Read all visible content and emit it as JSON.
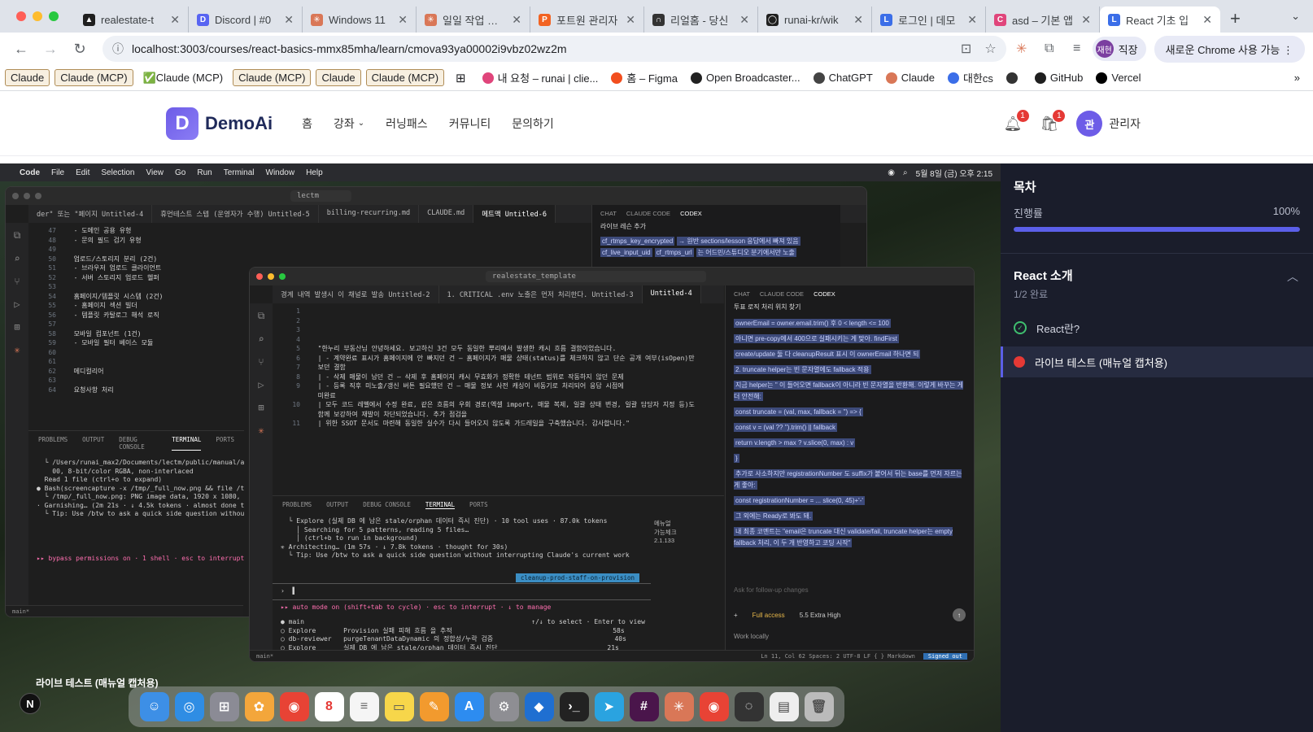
{
  "browser": {
    "tabs": [
      {
        "title": "realestate-t",
        "icon": "github-icon",
        "color": "#1f1f1f",
        "glyph": "▲"
      },
      {
        "title": "Discord | #0",
        "icon": "discord-icon",
        "color": "#5865f2",
        "glyph": "D"
      },
      {
        "title": "Windows 11",
        "icon": "claude-icon",
        "color": "#d97757",
        "glyph": "✳"
      },
      {
        "title": "일일 작업 내역",
        "icon": "claude-icon",
        "color": "#d97757",
        "glyph": "✳"
      },
      {
        "title": "포트원 관리자",
        "icon": "portone-icon",
        "color": "#f26322",
        "glyph": "P"
      },
      {
        "title": "리얼홈 - 당신",
        "icon": "realhome-icon",
        "color": "#333333",
        "glyph": "∩"
      },
      {
        "title": "runai-kr/wik",
        "icon": "github-icon",
        "color": "#1f1f1f",
        "glyph": "◯"
      },
      {
        "title": "로그인 | 데모",
        "icon": "demo-icon",
        "color": "#3b6ee8",
        "glyph": "L"
      },
      {
        "title": "asd – 기본 앱",
        "icon": "app-icon",
        "color": "#e0457b",
        "glyph": "C"
      },
      {
        "title": "React 기초 입",
        "icon": "demo-icon",
        "color": "#3b6ee8",
        "glyph": "L",
        "active": true
      }
    ],
    "url": "localhost:3003/courses/react-basics-mmx85mha/learn/cmova93ya00002i9vbz02wz2m",
    "profile_label": "직장",
    "profile_avatar": "재현",
    "update_label": "새로운 Chrome 사용 가능",
    "bookmarks": [
      {
        "label": "Claude",
        "chip": true
      },
      {
        "label": "Claude (MCP)",
        "chip": true
      },
      {
        "label": "✅Claude (MCP)",
        "chip": false
      },
      {
        "label": "Claude (MCP)",
        "chip": true
      },
      {
        "label": "Claude",
        "chip": true
      },
      {
        "label": "Claude (MCP)",
        "chip": true
      }
    ],
    "bookmark_links": [
      {
        "label": "내 요청 – runai | clie...",
        "color": "#e0457b"
      },
      {
        "label": "홈 – Figma",
        "color": "#f24e1e"
      },
      {
        "label": "Open Broadcaster...",
        "color": "#222222"
      },
      {
        "label": "ChatGPT",
        "color": "#444444"
      },
      {
        "label": "Claude",
        "color": "#d97757"
      },
      {
        "label": "대한cs",
        "color": "#3b6ee8"
      },
      {
        "label": "",
        "color": "#333333"
      },
      {
        "label": "GitHub",
        "color": "#1f1f1f"
      },
      {
        "label": "Vercel",
        "color": "#000000"
      }
    ]
  },
  "site": {
    "logo_letter": "D",
    "logo_text": "DemoAi",
    "nav": [
      "홈",
      "강좌",
      "러닝패스",
      "커뮤니티",
      "문의하기"
    ],
    "bell_count": "1",
    "cart_count": "1",
    "user_avatar": "관",
    "user_name": "관리자"
  },
  "video": {
    "menubar": [
      "Code",
      "File",
      "Edit",
      "Selection",
      "View",
      "Go",
      "Run",
      "Terminal",
      "Window",
      "Help"
    ],
    "clock": "5월 8일 (금) 오후 2:15",
    "back_window": {
      "search": "lectm",
      "tabs": [
        "der\" 또는 \"페이지 Untitled-4",
        "휴먼테스트 스텝 (운영자가 수행) Untitled-5",
        "billing-recurring.md",
        "CLAUDE.md",
        "메트맥 Untitled-6"
      ],
      "lines": [
        {
          "n": "47",
          "t": "  - 도메인 공용 유형"
        },
        {
          "n": "48",
          "t": "  - 문의 필드 검기 유형"
        },
        {
          "n": "49",
          "t": ""
        },
        {
          "n": "50",
          "t": "  업로드/스토리지 분리 (2건)"
        },
        {
          "n": "51",
          "t": "  - 브라우저 업로드 클라이언트"
        },
        {
          "n": "52",
          "t": "  - 서버 스토리지 업로드 헬퍼"
        },
        {
          "n": "53",
          "t": ""
        },
        {
          "n": "54",
          "t": "  홈페이지/템플릿 시스템 (2건)"
        },
        {
          "n": "55",
          "t": "  - 홈페이지 섹션 빌더"
        },
        {
          "n": "56",
          "t": "  - 템플릿 카탈로그 해석 로직"
        },
        {
          "n": "57",
          "t": ""
        },
        {
          "n": "58",
          "t": "  모바일 컴포넌트 (1건)"
        },
        {
          "n": "59",
          "t": "  - 모바일 필터 베이스 모듈"
        },
        {
          "n": "60",
          "t": ""
        },
        {
          "n": "61",
          "t": ""
        },
        {
          "n": "62",
          "t": "  메디컬리어"
        },
        {
          "n": "63",
          "t": ""
        },
        {
          "n": "64",
          "t": "  요청사항 처리"
        }
      ],
      "panel_tabs": [
        "PROBLEMS",
        "OUTPUT",
        "DEBUG CONSOLE",
        "TERMINAL",
        "PORTS"
      ],
      "term": [
        "  └ /Users/runai_max2/Documents/lectm/public/manual/admi",
        "    00, 8-bit/color RGBA, non-interlaced",
        "",
        "  Read 1 file (ctrl+o to expand)",
        "",
        "● Bash(screencapture -x /tmp/_full_now.png && file /tmp/_",
        "  └ /tmp/_full_now.png: PNG image data, 1920 x 1080, 8-b",
        "",
        "· Garnishing… (2m 21s · ↓ 4.5k tokens · almost done think",
        "  └ Tip: Use /btw to ask a quick side question without i"
      ],
      "mode": "▸▸ bypass permissions on · 1 shell · esc to interrupt",
      "chat_tabs": [
        "CHAT",
        "CLAUDE CODE",
        "CODEX"
      ],
      "chat_title": "라이브 레슨 추가",
      "chat_hl": [
        "cf_rtmps_key_encrypted",
        "→ 원반 sections/lesson 응답에서 빠져 있음",
        "cf_live_input_uid",
        "cf_rtmps_url",
        "는 어드민/스튜디오 분기에서만 노출"
      ]
    },
    "front_window": {
      "search": "realestate_template",
      "tabs": [
        "경계 내역 발생시 이 채널로 발송 Untitled-2",
        "1. CRITICAL .env 노출은 먼저 처리한다. Untitled-3",
        "Untitled-4"
      ],
      "lines": [
        {
          "n": "1",
          "t": ""
        },
        {
          "n": "2",
          "t": ""
        },
        {
          "n": "3",
          "t": ""
        },
        {
          "n": "4",
          "t": ""
        },
        {
          "n": "5",
          "t": "  \"한누리 부동산님 안녕하세요. 보고하신 3건 모두 동일한 뿌리에서 발생한 캐시 흐름 결함이었습니다."
        },
        {
          "n": "6",
          "t": "  | - 계약완료 표시가 홈페이지에 안 빠지던 건 — 홈페이지가 매물 상태(status)를 체크하지 않고 단순 공개 여부(isOpen)만"
        },
        {
          "n": "7",
          "t": "  보던 결함"
        },
        {
          "n": "8",
          "t": "  | - 삭제 매물이 남던 건 — 삭제 후 홈페이지 캐시 무효화가 정확한 테넌트 범위로 작동하지 않던 문제"
        },
        {
          "n": "9",
          "t": "  | - 등록 직후 미노출/갱신 버튼 필요했던 건 — 매물 정보 사전 캐싱이 비동기로 처리되어 응답 시점에"
        },
        {
          "n": "",
          "t": "  미완료"
        },
        {
          "n": "10",
          "t": "  | 모두 코드 레벨에서 수정 완료, 같은 흐름의 우회 경로(엑셀 import, 매물 복제, 일괄 상태 변경, 일괄 담당자 지정 등)도"
        },
        {
          "n": "",
          "t": "  함께 보강하여 재발이 차단되었습니다. 추가 점검을"
        },
        {
          "n": "11",
          "t": "  | 위한 SSOT 문서도 마련해 동일한 실수가 다시 들어오지 않도록 가드레일을 구축했습니다. 감사합니다.\""
        }
      ],
      "panel_tabs": [
        "PROBLEMS",
        "OUTPUT",
        "DEBUG CONSOLE",
        "TERMINAL",
        "PORTS"
      ],
      "terminals": [
        "메뉴얼",
        "가능체크",
        "2.1.133"
      ],
      "term": [
        "  └ Explore (실제 DB 에 남은 stale/orphan 데이터 즉시 진단) · 10 tool uses · 87.0k tokens",
        "    │ Searching for 5 patterns, reading 5 files…",
        "    │ (ctrl+b to run in background)",
        "",
        "✳ Architecting… (1m 57s · ↓ 7.8k tokens · thought for 30s)",
        "  └ Tip: Use /btw to ask a quick side question without interrupting Claude's current work"
      ],
      "branch_tag": "cleanup-prod-staff-on-provision",
      "mode": "▸▸ auto mode on (shift+tab to cycle) · esc to interrupt · ↓ to manage",
      "agents": [
        "● main                                                          ↑/↓ to select · Enter to view",
        "○ Explore       Provision 실패 피해 흐름 을 추적                                         58s",
        "○ db-reviewer   purgeTenantDataDynamic 의 정합성/누락 검증                               40s",
        "○ Explore       실제 DB 에 남은 stale/orphan 데이터 즉시 진단                            21s"
      ],
      "chat_tabs": [
        "CHAT",
        "CLAUDE CODE",
        "CODEX"
      ],
      "chat_title": "투표 로직 처리 위치 찾기",
      "chat_lines": [
        "ownerEmail = owner.email.trim() 후 0 < length <= 100",
        "아니면 pre-copy에서 400으로 실패시키는 게 맞아. findFirst",
        "create/update 둘 다 cleanupResult 표시 이 ownerEmail 하나면 되",
        "2. truncate helper는 빈 문자열에도 fallback 적용",
        "지금 helper는 '' 이 들어오면 fallback이 아니라 빈 문자열을 반환해. 이렇게 바꾸는 게 더 안전해:",
        "const truncate = (val, max, fallback = '') => {",
        "  const v = (val ?? '').trim() || fallback",
        "  return v.length > max ? v.slice(0, max) : v",
        "}",
        "추가로 사소하지만 registrationNumber 도 suffix가 붙어서 뒤는 base를 먼저 자르는 게 좋아:",
        "const registrationNumber = ... slice(0, 45)+'-'",
        "그 외에는 Ready로 봐도 돼.",
        "내 최종 코멘트는 \"email은 truncate 대신 validate/fail, truncate helper는 empty fallback 처리, 이 두 개 반영하고 코딩 시작\""
      ],
      "chat_placeholder": "Ask for follow-up changes",
      "access": "Full access",
      "model": "5.5 Extra High",
      "work": "Work locally",
      "status": "Ln 11, Col 62   Spaces: 2   UTF-8   LF   { } Markdown",
      "signed_out": "Signed out"
    },
    "desk_label": "라이브 테스트 (매뉴얼 캡처용)",
    "desk_n": "N"
  },
  "toc": {
    "title": "목차",
    "progress_label": "진행률",
    "progress_value": "100%",
    "progress_fraction": 1.0,
    "section_title": "React 소개",
    "section_sub": "1/2 완료",
    "lessons": [
      {
        "label": "React란?",
        "status": "completed"
      },
      {
        "label": "라이브 테스트 (매뉴얼 캡처용)",
        "status": "live",
        "current": true
      }
    ]
  }
}
